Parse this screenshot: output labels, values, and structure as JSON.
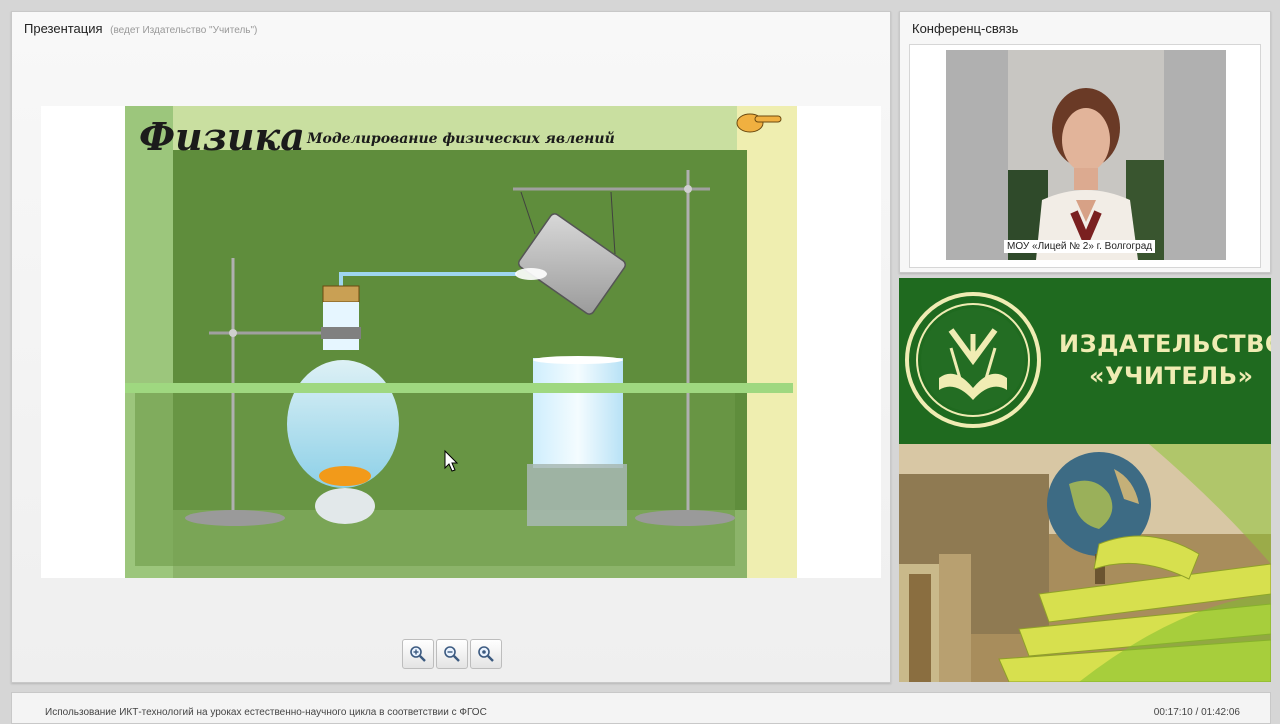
{
  "presentation": {
    "title": "Презентация",
    "subtitle": "(ведет Издательство \"Учитель\")",
    "slide": {
      "heading": "Физика",
      "subheading": "Моделирование физических явлений"
    },
    "zoom_buttons": [
      "zoom-in",
      "zoom-out",
      "zoom-reset"
    ]
  },
  "conference": {
    "title": "Конференц-связь",
    "video_caption": "МОУ «Лицей № 2» г. Волгоград"
  },
  "ad": {
    "line1": "ИЗДАТЕЛЬСТВО",
    "line2": "«УЧИТЕЛЬ»"
  },
  "footer": {
    "event_title": "Использование ИКТ-технологий на уроках естественно-научного цикла в соответствии с ФГОС",
    "time_current": "00:17:10",
    "time_total": "01:42:06"
  },
  "colors": {
    "slide_green": "#6f9a4a",
    "ad_green": "#1f6a1f",
    "ad_text": "#f0ecb3"
  }
}
